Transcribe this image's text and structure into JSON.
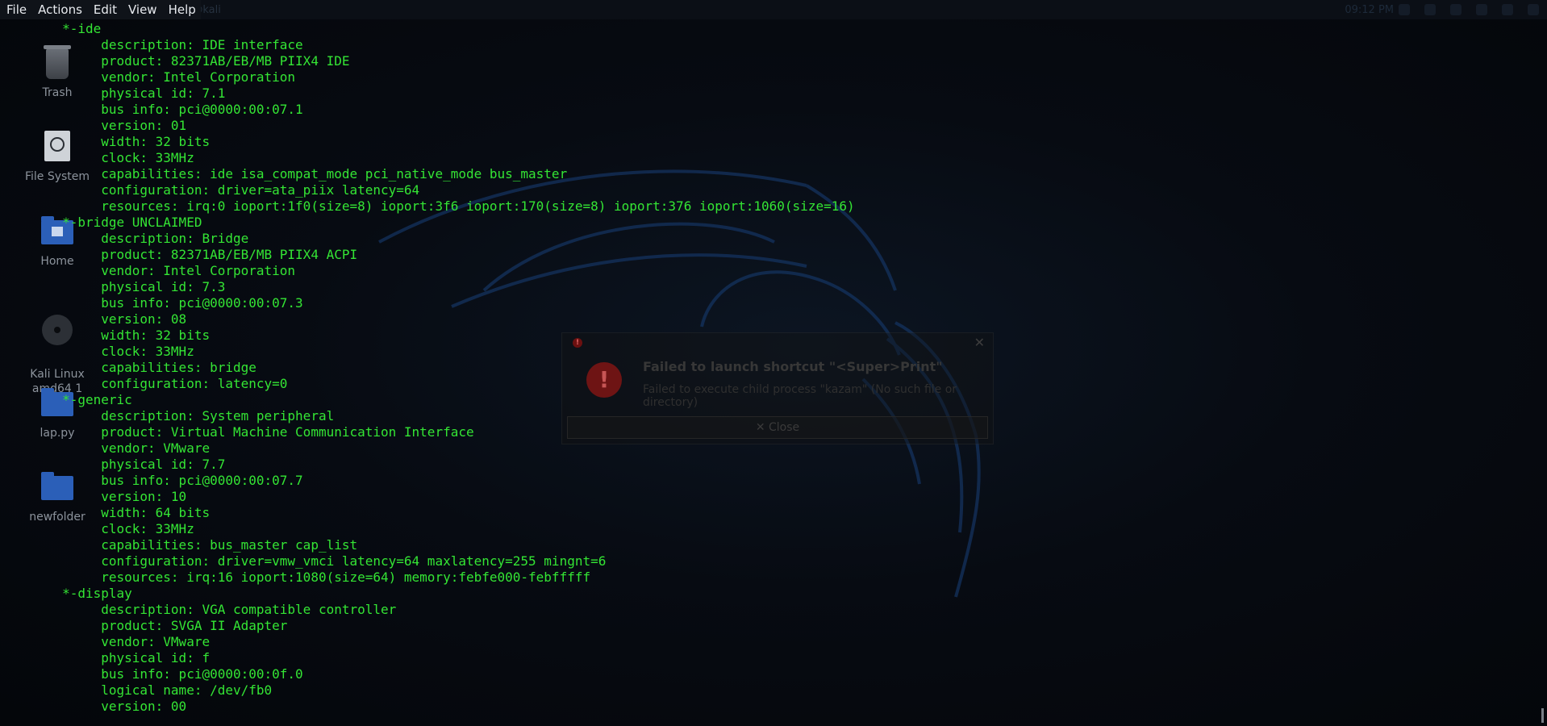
{
  "menubar": {
    "items": [
      "File",
      "Actions",
      "Edit",
      "View",
      "Help"
    ]
  },
  "window_title": "abc@kali",
  "desktop": {
    "icons": [
      {
        "label": "Trash",
        "icon": "trash-icon"
      },
      {
        "label": "File System",
        "icon": "drive-icon"
      },
      {
        "label": "Home",
        "icon": "home-folder-icon"
      },
      {
        "label": "Kali Linux\namd64 1",
        "icon": "disc-icon"
      },
      {
        "label": "lap.py",
        "icon": "folder-icon"
      },
      {
        "label": "newfolder",
        "icon": "folder-icon"
      }
    ]
  },
  "terminal": {
    "lines": [
      "        *-ide",
      "             description: IDE interface",
      "             product: 82371AB/EB/MB PIIX4 IDE",
      "             vendor: Intel Corporation",
      "             physical id: 7.1",
      "             bus info: pci@0000:00:07.1",
      "             version: 01",
      "             width: 32 bits",
      "             clock: 33MHz",
      "             capabilities: ide isa_compat_mode pci_native_mode bus_master",
      "             configuration: driver=ata_piix latency=64",
      "             resources: irq:0 ioport:1f0(size=8) ioport:3f6 ioport:170(size=8) ioport:376 ioport:1060(size=16)",
      "        *-bridge UNCLAIMED",
      "             description: Bridge",
      "             product: 82371AB/EB/MB PIIX4 ACPI",
      "             vendor: Intel Corporation",
      "             physical id: 7.3",
      "             bus info: pci@0000:00:07.3",
      "             version: 08",
      "             width: 32 bits",
      "             clock: 33MHz",
      "             capabilities: bridge",
      "             configuration: latency=0",
      "        *-generic",
      "             description: System peripheral",
      "             product: Virtual Machine Communication Interface",
      "             vendor: VMware",
      "             physical id: 7.7",
      "             bus info: pci@0000:00:07.7",
      "             version: 10",
      "             width: 64 bits",
      "             clock: 33MHz",
      "             capabilities: bus_master cap_list",
      "             configuration: driver=vmw_vmci latency=64 maxlatency=255 mingnt=6",
      "             resources: irq:16 ioport:1080(size=64) memory:febfe000-febfffff",
      "        *-display",
      "             description: VGA compatible controller",
      "             product: SVGA II Adapter",
      "             vendor: VMware",
      "             physical id: f",
      "             bus info: pci@0000:00:0f.0",
      "             logical name: /dev/fb0",
      "             version: 00"
    ]
  },
  "dialog": {
    "heading": "Failed to launch shortcut \"<Super>Print\"",
    "detail": "Failed to execute child process \"kazam\" (No such file or directory)",
    "close_label": "✕ Close"
  },
  "panel": {
    "clock": "09:12 PM"
  },
  "colors": {
    "terminal_text": "#34e534",
    "background": "#05080d",
    "error_red": "#6e1414"
  }
}
